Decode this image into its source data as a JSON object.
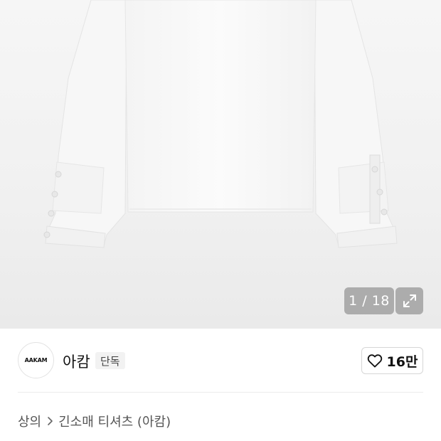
{
  "gallery": {
    "counter": "1 / 18",
    "current_index": 1,
    "total_images": 18,
    "expand_icon": "expand-icon"
  },
  "brand": {
    "logo_text": "AAKAM",
    "name": "아캄",
    "badge": "단독"
  },
  "like": {
    "icon": "heart-outline-icon",
    "count": "16만"
  },
  "breadcrumb": {
    "items": [
      "상의",
      "긴소매 티셔츠 (아캄)"
    ],
    "separator_icon": "chevron-right-icon"
  },
  "colors": {
    "gallery_bg": "#f1f1f1",
    "overlay": "#787878",
    "text_primary": "#111111",
    "text_secondary": "#555555"
  }
}
